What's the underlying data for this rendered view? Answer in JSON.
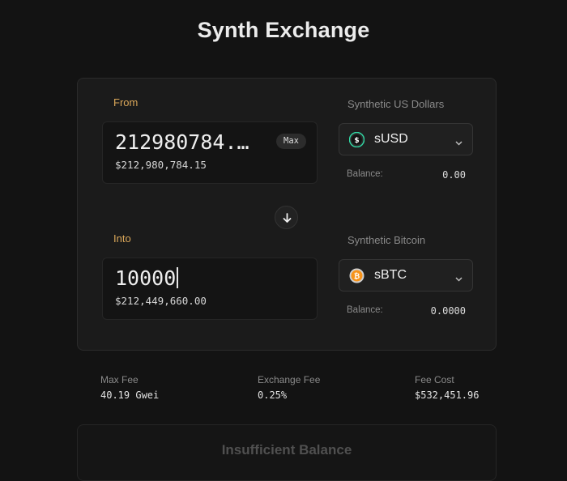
{
  "page": {
    "title": "Synth Exchange"
  },
  "from": {
    "label": "From",
    "amount": "212980784.…",
    "usd_value": "$212,980,784.15",
    "max_label": "Max",
    "token_full_name": "Synthetic US Dollars",
    "token_symbol": "sUSD",
    "token_icon": "dollar-coin-icon",
    "balance_label": "Balance:",
    "balance_value": "0.00"
  },
  "into": {
    "label": "Into",
    "amount": "10000",
    "usd_value": "$212,449,660.00",
    "token_full_name": "Synthetic Bitcoin",
    "token_symbol": "sBTC",
    "token_icon": "bitcoin-icon",
    "balance_label": "Balance:",
    "balance_value": "0.0000"
  },
  "fees": {
    "max_fee_label": "Max Fee",
    "max_fee_value": "40.19 Gwei",
    "exchange_fee_label": "Exchange Fee",
    "exchange_fee_value": "0.25%",
    "fee_cost_label": "Fee Cost",
    "fee_cost_value": "$532,451.96"
  },
  "submit": {
    "label": "Insufficient Balance"
  },
  "colors": {
    "background": "#131313",
    "card": "#1b1b1b",
    "accent_label": "#d9a659",
    "susd_icon": "#31d8a4",
    "sbtc_icon": "#f7931a"
  }
}
